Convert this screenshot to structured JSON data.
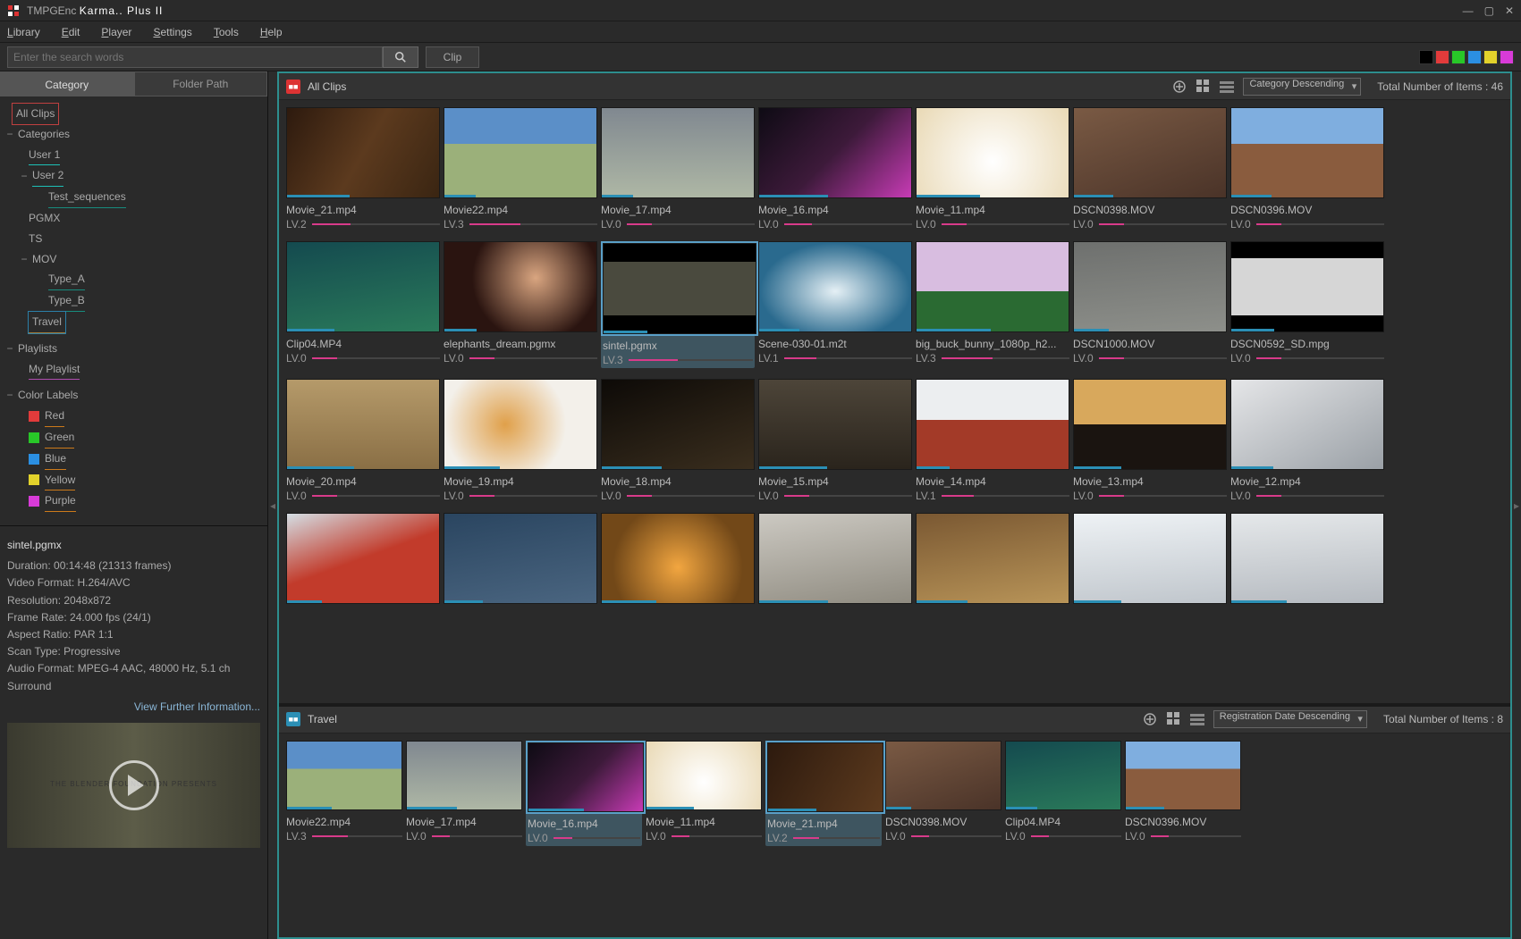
{
  "app": {
    "name1": "TMPGEnc",
    "name2": "Karma.. Plus II"
  },
  "menu": [
    "Library",
    "Edit",
    "Player",
    "Settings",
    "Tools",
    "Help"
  ],
  "search": {
    "placeholder": "Enter the search words"
  },
  "modeBtn": "Clip",
  "colorPalette": [
    "#000000",
    "#e23b3b",
    "#28c728",
    "#2b8fe2",
    "#e2d22b",
    "#d83bd8"
  ],
  "leftTabs": {
    "category": "Category",
    "folder": "Folder Path"
  },
  "tree": {
    "allClips": "All Clips",
    "categories": "Categories",
    "user1": "User 1",
    "user2": "User 2",
    "testSeq": "Test_sequences",
    "pgmx": "PGMX",
    "ts": "TS",
    "mov": "MOV",
    "typeA": "Type_A",
    "typeB": "Type_B",
    "travel": "Travel",
    "playlists": "Playlists",
    "myPlaylist": "My Playlist",
    "colorLabels": "Color Labels",
    "red": "Red",
    "green": "Green",
    "blue": "Blue",
    "yellow": "Yellow",
    "purple": "Purple"
  },
  "info": {
    "filename": "sintel.pgmx",
    "lines": [
      "Duration: 00:14:48 (21313 frames)",
      "Video Format: H.264/AVC",
      "Resolution: 2048x872",
      "Frame Rate: 24.000 fps (24/1)",
      "Aspect Ratio: PAR 1:1",
      "Scan Type: Progressive",
      "Audio Format: MPEG-4 AAC, 48000 Hz, 5.1 ch Surround"
    ],
    "more": "View Further Information..."
  },
  "upper": {
    "title": "All Clips",
    "sort": "Category Descending",
    "count": "Total Number of Items : 46",
    "clips": [
      {
        "name": "Movie_21.mp4",
        "lv": "LV.2",
        "fill": 30,
        "bg": "linear-gradient(120deg,#2d1a0e,#5c3a1e,#3a2512)"
      },
      {
        "name": "Movie22.mp4",
        "lv": "LV.3",
        "fill": 40,
        "bg": "linear-gradient(180deg,#5b8fc8 40%,#9bb07a 40%)"
      },
      {
        "name": "Movie_17.mp4",
        "lv": "LV.0",
        "fill": 20,
        "bg": "linear-gradient(180deg,#808890,#aeb7a5)"
      },
      {
        "name": "Movie_16.mp4",
        "lv": "LV.0",
        "fill": 22,
        "bg": "linear-gradient(135deg,#0e0b14,#3d1a3a,#c73bb5)"
      },
      {
        "name": "Movie_11.mp4",
        "lv": "LV.0",
        "fill": 20,
        "bg": "radial-gradient(circle at 50% 60%,#fff,#e9d9b5)"
      },
      {
        "name": "DSCN0398.MOV",
        "lv": "LV.0",
        "fill": 20,
        "bg": "linear-gradient(160deg,#7a5a44,#4a3328)"
      },
      {
        "name": "DSCN0396.MOV",
        "lv": "LV.0",
        "fill": 20,
        "bg": "linear-gradient(180deg,#7faedf 40%,#8a5c3e 40%)"
      },
      {
        "name": "Clip04.MP4",
        "lv": "LV.0",
        "fill": 20,
        "bg": "linear-gradient(170deg,#144a4f,#2a7a5a)"
      },
      {
        "name": "elephants_dream.pgmx",
        "lv": "LV.0",
        "fill": 20,
        "bg": "radial-gradient(circle at 60% 40%,#d9a580,#2a1410 60%)"
      },
      {
        "name": "sintel.pgmx",
        "lv": "LV.3",
        "fill": 40,
        "sel": true,
        "bg": "linear-gradient(180deg,#000 20%,#4a4a3e 20% 80%,#000 80%)"
      },
      {
        "name": "Scene-030-01.m2t",
        "lv": "LV.1",
        "fill": 25,
        "bg": "radial-gradient(ellipse at 50% 55%,#e5f0f5,#2a6a8e 70%)"
      },
      {
        "name": "big_buck_bunny_1080p_h2...",
        "lv": "LV.3",
        "fill": 40,
        "bg": "linear-gradient(180deg,#d8bde0 55%,#2a6a32 55%)"
      },
      {
        "name": "DSCN1000.MOV",
        "lv": "LV.0",
        "fill": 20,
        "bg": "linear-gradient(175deg,#6e706e,#8d8f8a)"
      },
      {
        "name": "DSCN0592_SD.mpg",
        "lv": "LV.0",
        "fill": 20,
        "bg": "linear-gradient(180deg,#000 18%,#d6d6d6 18% 82%,#000 82%)"
      },
      {
        "name": "Movie_20.mp4",
        "lv": "LV.0",
        "fill": 20,
        "bg": "linear-gradient(180deg,#b59a6a,#8a6f45)"
      },
      {
        "name": "Movie_19.mp4",
        "lv": "LV.0",
        "fill": 20,
        "bg": "radial-gradient(circle at 40% 50%,#e0a04a,#f3f0ea 60%)"
      },
      {
        "name": "Movie_18.mp4",
        "lv": "LV.0",
        "fill": 20,
        "bg": "linear-gradient(160deg,#0d0a07,#3a2e1e)"
      },
      {
        "name": "Movie_15.mp4",
        "lv": "LV.0",
        "fill": 20,
        "bg": "linear-gradient(180deg,#4d4539,#2a241c)"
      },
      {
        "name": "Movie_14.mp4",
        "lv": "LV.1",
        "fill": 25,
        "bg": "linear-gradient(180deg,#eceef0 45%,#a33a28 45%)"
      },
      {
        "name": "Movie_13.mp4",
        "lv": "LV.0",
        "fill": 20,
        "bg": "linear-gradient(180deg,#d8a85c 50%,#1a1410 50%)"
      },
      {
        "name": "Movie_12.mp4",
        "lv": "LV.0",
        "fill": 20,
        "bg": "linear-gradient(150deg,#e5e6e8,#9aa0a6)"
      },
      {
        "name": "",
        "lv": "",
        "fill": 0,
        "bg": "linear-gradient(160deg,#d4dee4,#c23b2b 50%)"
      },
      {
        "name": "",
        "lv": "",
        "fill": 0,
        "bg": "linear-gradient(170deg,#2a4560,#4a6580)"
      },
      {
        "name": "",
        "lv": "",
        "fill": 0,
        "bg": "radial-gradient(circle at 50% 60%,#f2a640,#724818 70%)"
      },
      {
        "name": "",
        "lv": "",
        "fill": 0,
        "bg": "linear-gradient(170deg,#ccc9c2,#8f8b80)"
      },
      {
        "name": "",
        "lv": "",
        "fill": 0,
        "bg": "linear-gradient(170deg,#7a5832,#b89458)"
      },
      {
        "name": "",
        "lv": "",
        "fill": 0,
        "bg": "linear-gradient(175deg,#eef2f5,#c0c6cc)"
      },
      {
        "name": "",
        "lv": "",
        "fill": 0,
        "bg": "linear-gradient(175deg,#e5e8ea,#b5bac0)"
      }
    ]
  },
  "lower": {
    "title": "Travel",
    "sort": "Registration Date Descending",
    "count": "Total Number of Items : 8",
    "clips": [
      {
        "name": "Movie22.mp4",
        "lv": "LV.3",
        "fill": 40,
        "bg": "linear-gradient(180deg,#5b8fc8 40%,#9bb07a 40%)"
      },
      {
        "name": "Movie_17.mp4",
        "lv": "LV.0",
        "fill": 20,
        "bg": "linear-gradient(180deg,#808890,#aeb7a5)"
      },
      {
        "name": "Movie_16.mp4",
        "lv": "LV.0",
        "fill": 22,
        "sel": true,
        "bg": "linear-gradient(135deg,#0e0b14,#3d1a3a,#c73bb5)"
      },
      {
        "name": "Movie_11.mp4",
        "lv": "LV.0",
        "fill": 20,
        "bg": "radial-gradient(circle at 50% 60%,#fff,#e9d9b5)"
      },
      {
        "name": "Movie_21.mp4",
        "lv": "LV.2",
        "fill": 30,
        "sel": true,
        "bg": "linear-gradient(120deg,#2d1a0e,#5c3a1e)"
      },
      {
        "name": "DSCN0398.MOV",
        "lv": "LV.0",
        "fill": 20,
        "bg": "linear-gradient(160deg,#7a5a44,#4a3328)"
      },
      {
        "name": "Clip04.MP4",
        "lv": "LV.0",
        "fill": 20,
        "bg": "linear-gradient(170deg,#144a4f,#2a7a5a)"
      },
      {
        "name": "DSCN0396.MOV",
        "lv": "LV.0",
        "fill": 20,
        "bg": "linear-gradient(180deg,#7faedf 40%,#8a5c3e 40%)"
      }
    ]
  }
}
